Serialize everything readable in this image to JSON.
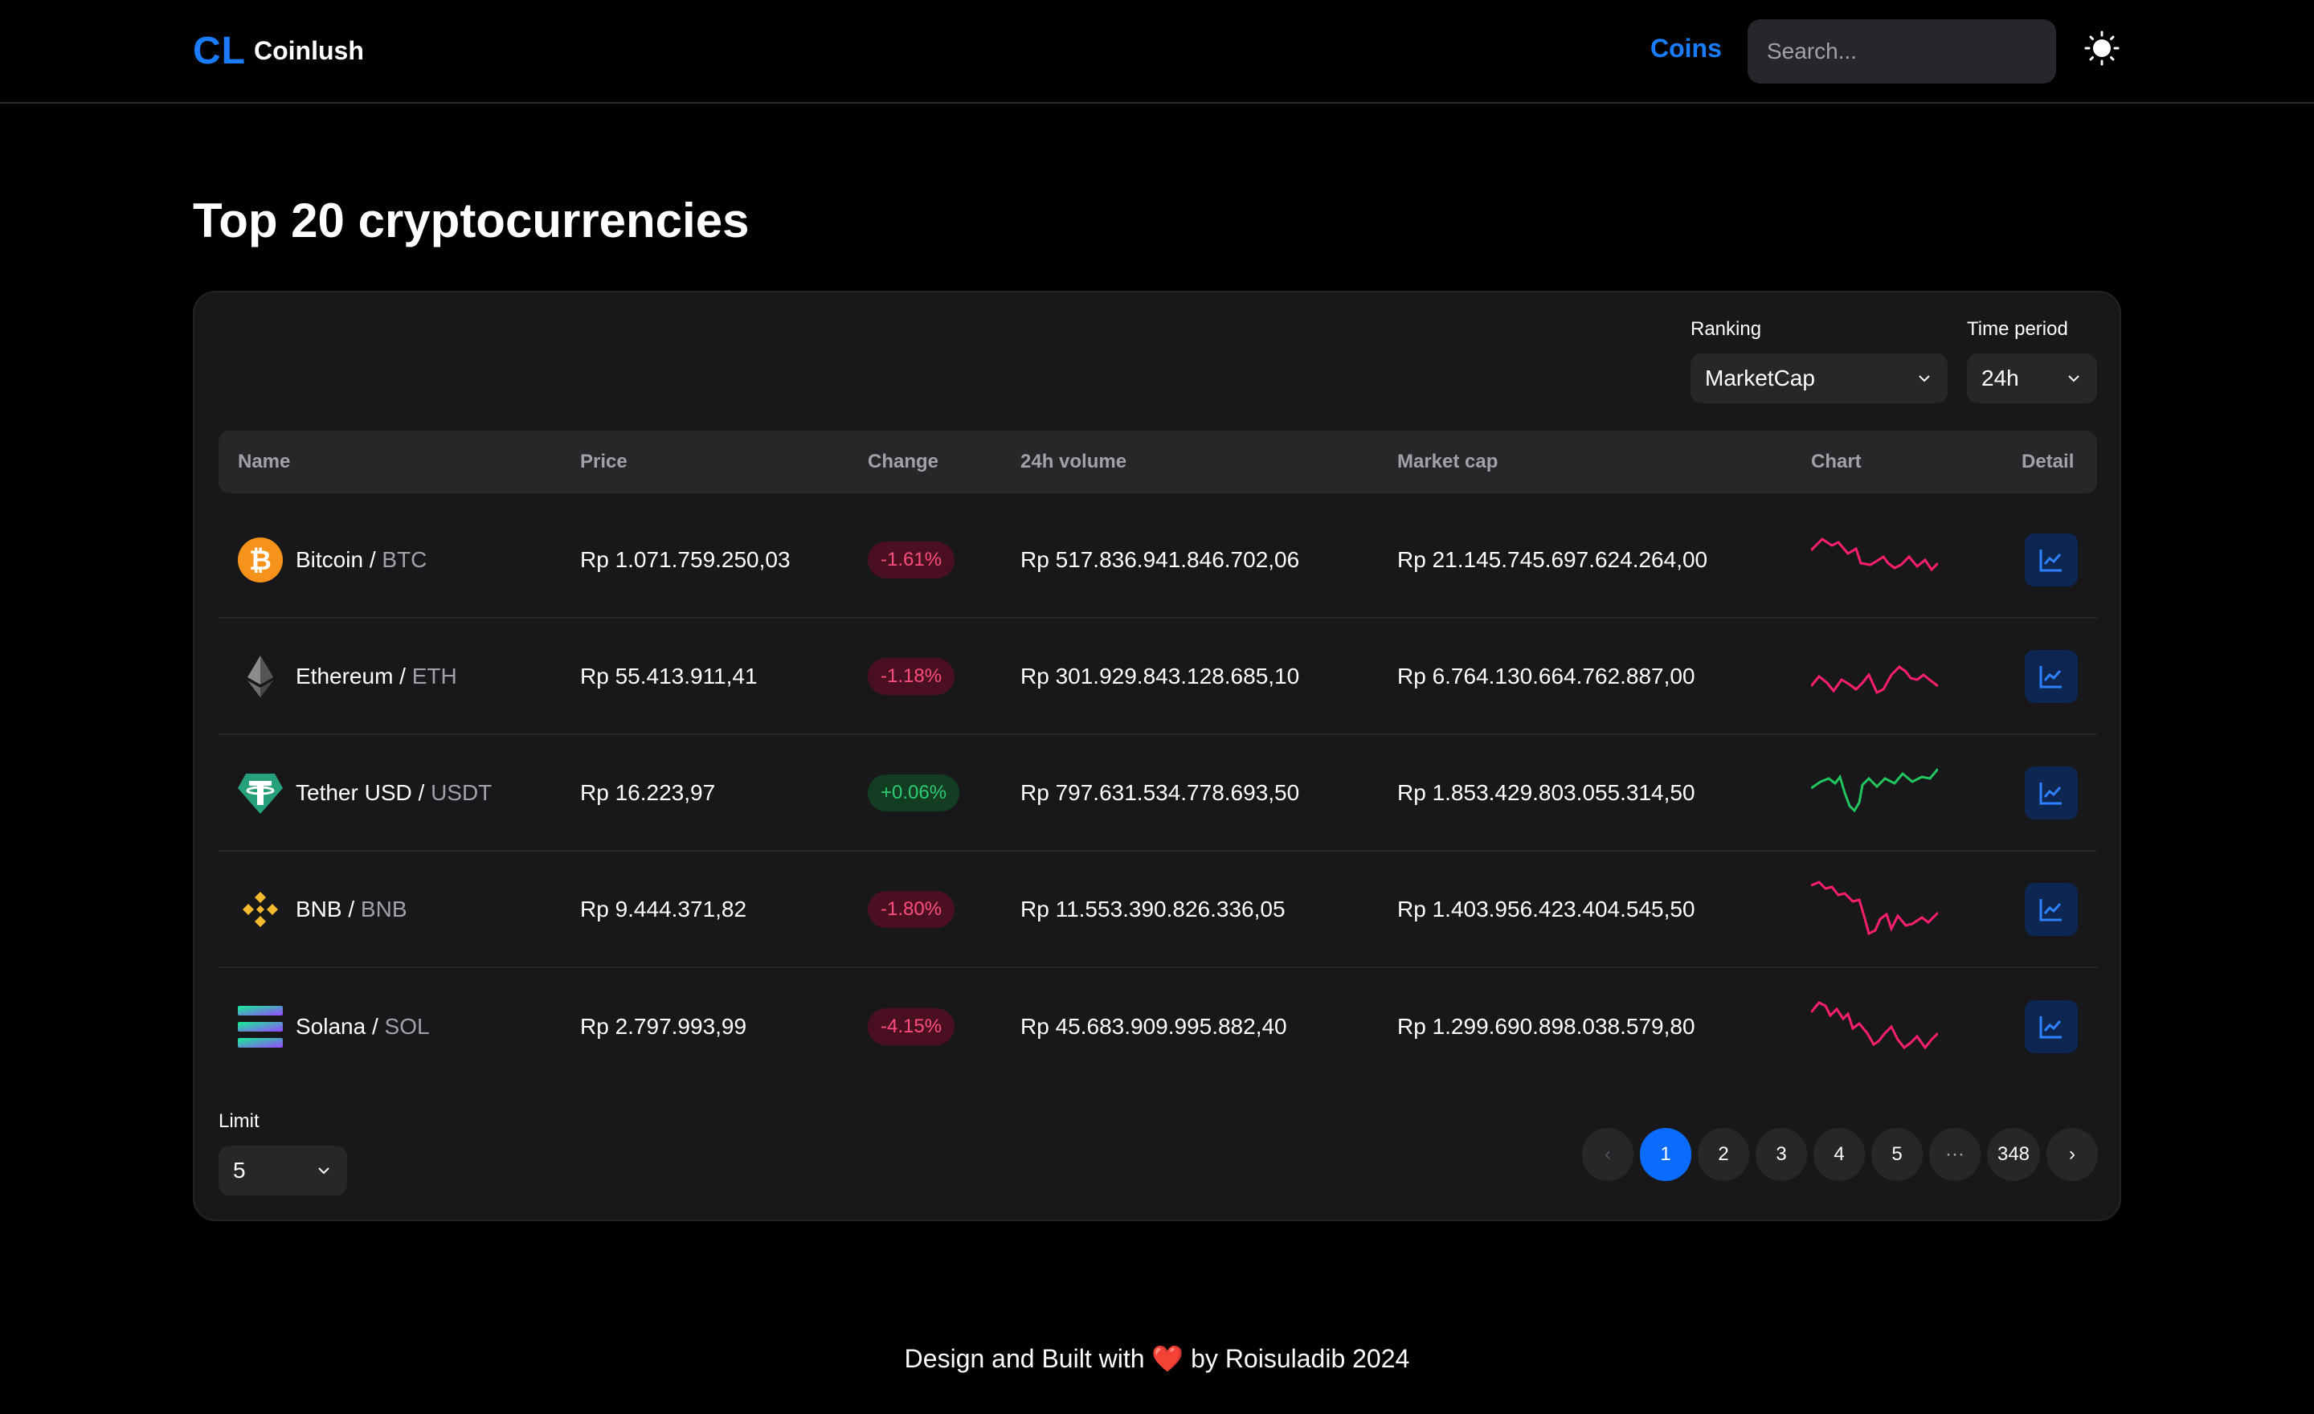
{
  "header": {
    "logo_mark": "CL",
    "logo_text": "Coinlush",
    "nav_coins": "Coins",
    "search_placeholder": "Search...",
    "theme_icon": "sun-icon"
  },
  "page_title": "Top 20 cryptocurrencies",
  "filters": {
    "ranking_label": "Ranking",
    "ranking_value": "MarketCap",
    "time_label": "Time period",
    "time_value": "24h"
  },
  "table": {
    "headers": [
      "Name",
      "Price",
      "Change",
      "24h volume",
      "Market cap",
      "Chart",
      "Detail"
    ],
    "rows": [
      {
        "name": "Bitcoin",
        "sep": " / ",
        "symbol": "BTC",
        "price": "Rp 1.071.759.250,03",
        "change": "-1.61%",
        "trend": "neg",
        "volume": "Rp 517.836.941.846.702,06",
        "market_cap": "Rp 21.145.745.697.624.264,00",
        "icon": "bitcoin-icon"
      },
      {
        "name": "Ethereum",
        "sep": " / ",
        "symbol": "ETH",
        "price": "Rp 55.413.911,41",
        "change": "-1.18%",
        "trend": "neg",
        "volume": "Rp 301.929.843.128.685,10",
        "market_cap": "Rp 6.764.130.664.762.887,00",
        "icon": "ethereum-icon"
      },
      {
        "name": "Tether USD",
        "sep": " / ",
        "symbol": "USDT",
        "price": "Rp 16.223,97",
        "change": "+0.06%",
        "trend": "pos",
        "volume": "Rp 797.631.534.778.693,50",
        "market_cap": "Rp 1.853.429.803.055.314,50",
        "icon": "tether-icon"
      },
      {
        "name": "BNB",
        "sep": " / ",
        "symbol": "BNB",
        "price": "Rp 9.444.371,82",
        "change": "-1.80%",
        "trend": "neg",
        "volume": "Rp 11.553.390.826.336,05",
        "market_cap": "Rp 1.403.956.423.404.545,50",
        "icon": "bnb-icon"
      },
      {
        "name": "Solana",
        "sep": " / ",
        "symbol": "SOL",
        "price": "Rp 2.797.993,99",
        "change": "-4.15%",
        "trend": "neg",
        "volume": "Rp 45.683.909.995.882,40",
        "market_cap": "Rp 1.299.690.898.038.579,80",
        "icon": "solana-icon"
      }
    ]
  },
  "limit": {
    "label": "Limit",
    "value": "5"
  },
  "pagination": {
    "prev": "‹",
    "pages": [
      "1",
      "2",
      "3",
      "4",
      "5"
    ],
    "ellipsis": "···",
    "last": "348",
    "next": "›",
    "active": "1"
  },
  "footer": {
    "before": "Design and Built with ",
    "heart": "❤️",
    "after": " by Roisuladib 2024"
  },
  "colors": {
    "accent": "#1a7dff",
    "negative": "#ff1f6b",
    "positive": "#22c55e",
    "background": "#000000",
    "card": "#18181b"
  }
}
